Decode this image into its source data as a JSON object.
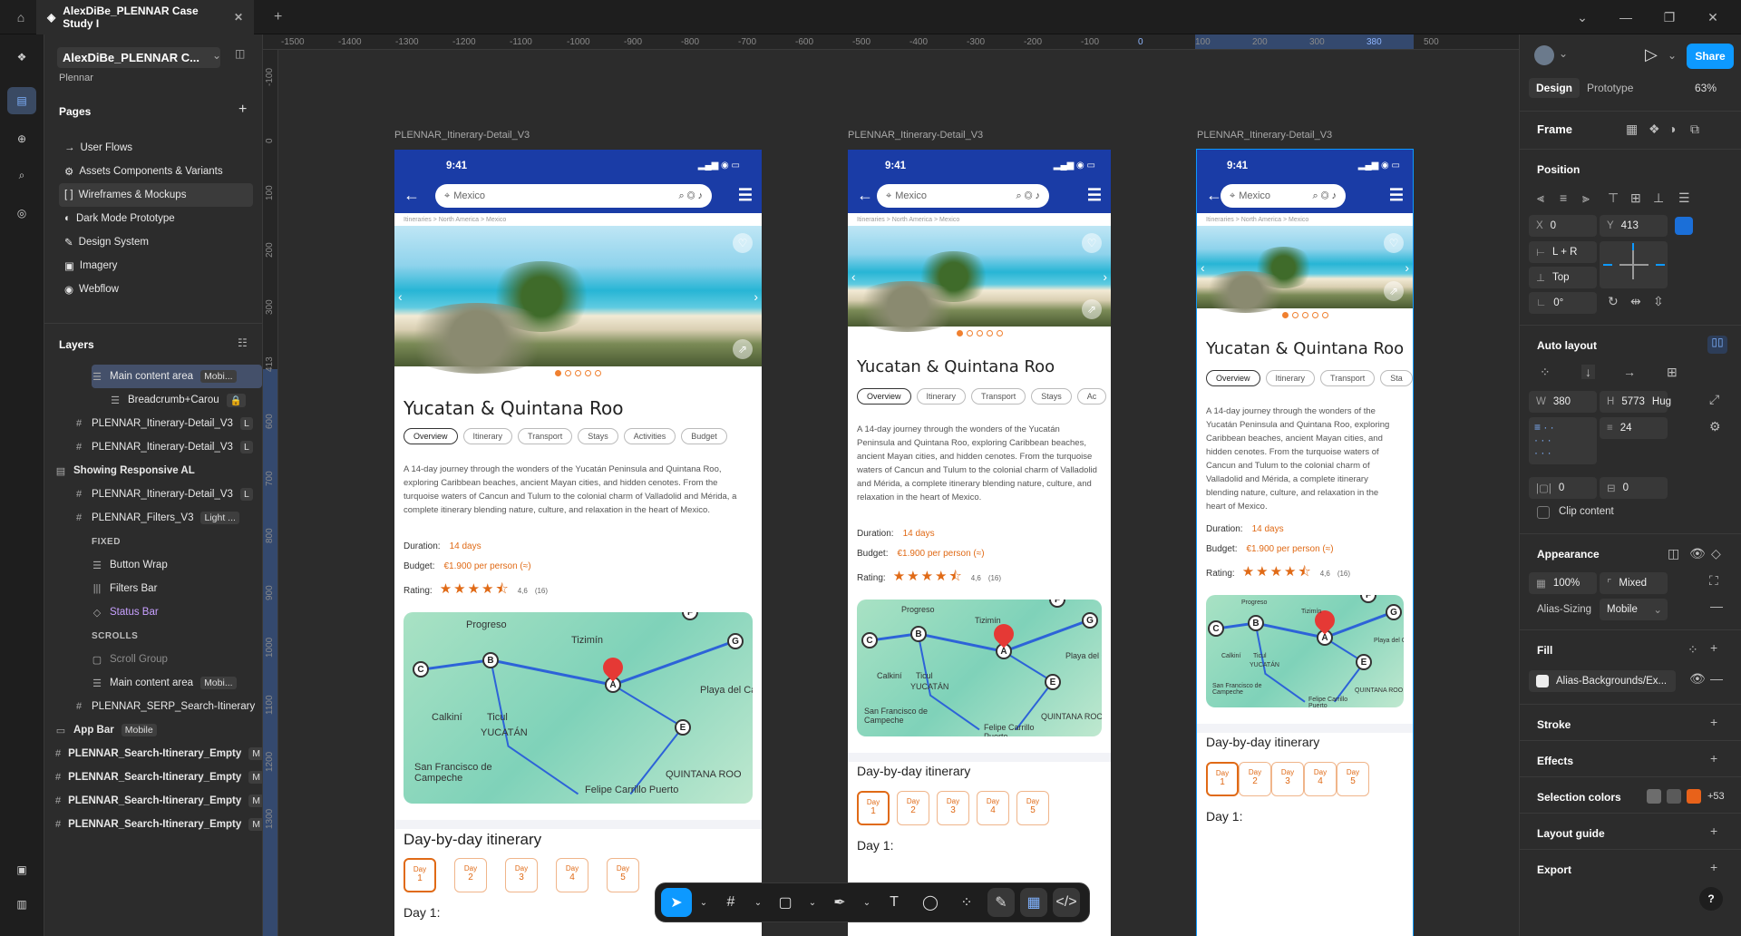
{
  "titlebar": {
    "file_tab": "AlexDiBe_PLENNAR Case Study I",
    "new_tab": "+"
  },
  "left": {
    "file_name": "AlexDiBe_PLENNAR C...",
    "team": "Plennar",
    "pages_title": "Pages",
    "pages": [
      {
        "icon": "→",
        "label": "User Flows"
      },
      {
        "icon": "⚙",
        "label": "Assets Components & Variants"
      },
      {
        "icon": "[ ]",
        "label": "Wireframes & Mockups"
      },
      {
        "icon": "◐",
        "label": "Dark Mode Prototype"
      },
      {
        "icon": "✎",
        "label": "Design System"
      },
      {
        "icon": "▣",
        "label": "Imagery"
      },
      {
        "icon": "◉",
        "label": "Webflow"
      }
    ],
    "layers_title": "Layers",
    "layers": [
      {
        "label": "Main content area",
        "badge": "Mobi...",
        "indent": 44,
        "sel": true,
        "icon": "☰"
      },
      {
        "label": "Breadcrumb+Carou",
        "badge": "🔒",
        "indent": 64,
        "icon": "☰"
      },
      {
        "label": "PLENNAR_Itinerary-Detail_V3",
        "badge": "L",
        "indent": 24,
        "icon": "#"
      },
      {
        "label": "PLENNAR_Itinerary-Detail_V3",
        "badge": "L",
        "indent": 24,
        "icon": "#"
      },
      {
        "label": "Showing Responsive AL",
        "badge": "",
        "indent": 4,
        "icon": "▤",
        "bold": true
      },
      {
        "label": "PLENNAR_Itinerary-Detail_V3",
        "badge": "L",
        "indent": 24,
        "icon": "#"
      },
      {
        "label": "PLENNAR_Filters_V3",
        "badge": "Light ...",
        "indent": 24,
        "icon": "#"
      },
      {
        "label": "FIXED",
        "badge": "",
        "indent": 44,
        "icon": "",
        "section": true
      },
      {
        "label": "Button Wrap",
        "badge": "",
        "indent": 44,
        "icon": "☰"
      },
      {
        "label": "Filters Bar",
        "badge": "",
        "indent": 44,
        "icon": "|||"
      },
      {
        "label": "Status Bar",
        "badge": "",
        "indent": 44,
        "icon": "◇",
        "purple": true
      },
      {
        "label": "SCROLLS",
        "badge": "",
        "indent": 44,
        "icon": "",
        "section": true
      },
      {
        "label": "Scroll Group",
        "badge": "",
        "indent": 44,
        "icon": "▢",
        "dim": true
      },
      {
        "label": "Main content area",
        "badge": "Mobi...",
        "indent": 44,
        "icon": "☰"
      },
      {
        "label": "PLENNAR_SERP_Search-Itinerary",
        "badge": "",
        "indent": 24,
        "icon": "#"
      },
      {
        "label": "App Bar",
        "badge": "Mobile",
        "indent": 4,
        "icon": "▭",
        "bold": true
      },
      {
        "label": "PLENNAR_Search-Itinerary_Empty",
        "badge": "M",
        "indent": 4,
        "icon": "#",
        "bold": true
      },
      {
        "label": "PLENNAR_Search-Itinerary_Empty",
        "badge": "M",
        "indent": 4,
        "icon": "#",
        "bold": true
      },
      {
        "label": "PLENNAR_Search-Itinerary_Empty",
        "badge": "M",
        "indent": 4,
        "icon": "#",
        "bold": true
      },
      {
        "label": "PLENNAR_Search-Itinerary_Empty",
        "badge": "M",
        "indent": 4,
        "icon": "#",
        "bold": true
      }
    ]
  },
  "ruler": {
    "top": [
      "-1500",
      "-1400",
      "-1300",
      "-1200",
      "-1100",
      "-1000",
      "-900",
      "-800",
      "-700",
      "-600",
      "-500",
      "-400",
      "-300",
      "-200",
      "-100",
      "0",
      "100",
      "200",
      "300",
      "380",
      "500"
    ],
    "left": [
      "-100",
      "0",
      "100",
      "200",
      "300",
      "413",
      "600",
      "700",
      "800",
      "900",
      "1000",
      "1100",
      "1200",
      "1300"
    ]
  },
  "frames": [
    {
      "label": "PLENNAR_Itinerary-Detail_V3"
    },
    {
      "label": "PLENNAR_Itinerary-Detail_V3"
    },
    {
      "label": "PLENNAR_Itinerary-Detail_V3"
    }
  ],
  "phone": {
    "time": "9:41",
    "search": "Mexico",
    "crumb": "Itineraries > North America > Mexico",
    "title": "Yucatan & Quintana Roo",
    "tabs": [
      "Overview",
      "Itinerary",
      "Transport",
      "Stays",
      "Activities",
      "Budget"
    ],
    "tabs_third": [
      "Overview",
      "Itinerary",
      "Transport",
      "Sta"
    ],
    "tabs_second": [
      "Overview",
      "Itinerary",
      "Transport",
      "Stays",
      "Ac"
    ],
    "desc": "A 14-day journey through the wonders of the Yucatán Peninsula and Quintana Roo, exploring Caribbean beaches, ancient Mayan cities, and hidden cenotes. From the turquoise waters of Cancun and Tulum to the colonial charm of Valladolid and Mérida, a complete itinerary blending nature, culture, and relaxation in the heart of Mexico.",
    "duration_label": "Duration:",
    "duration": "14 days",
    "budget_label": "Budget:",
    "budget": "€1.900 per person (≈)",
    "rating_label": "Rating:",
    "rating": "4,6",
    "reviews": "(16)",
    "stars": "★★★★⯪",
    "map_labels": [
      "Progreso",
      "Tizimín",
      "Calkiní",
      "Ticul",
      "YUCATÁN",
      "San Francisco de Campeche",
      "Felipe Carrillo Puerto",
      "Playa del Carmen",
      "QUINTANA ROO"
    ],
    "day_title": "Day-by-day itinerary",
    "day_word": "Day",
    "days": [
      "1",
      "2",
      "3",
      "4",
      "5"
    ],
    "day1": "Day 1:"
  },
  "toolbar": {
    "tools": [
      "cursor",
      "frame",
      "rectangle",
      "pen",
      "text",
      "comment",
      "actions",
      "draw",
      "dev",
      "code"
    ]
  },
  "right": {
    "tabs": [
      "Design",
      "Prototype"
    ],
    "zoom": "63%",
    "share": "Share",
    "frame": "Frame",
    "position": "Position",
    "x_label": "X",
    "x": "0",
    "y_label": "Y",
    "y": "413",
    "constraint_h": "L + R",
    "constraint_v": "Top",
    "rotation": "0°",
    "autolayout": "Auto layout",
    "w_label": "W",
    "w": "380",
    "h_label": "H",
    "h": "5773",
    "h_mode": "Hug",
    "gap": "24",
    "pad_h": "0",
    "pad_v": "0",
    "clip": "Clip content",
    "appearance": "Appearance",
    "opacity": "100%",
    "radius": "Mixed",
    "alias_label": "Alias-Sizing",
    "alias": "Mobile",
    "fill": "Fill",
    "fill_value": "Alias-Backgrounds/Ex...",
    "stroke": "Stroke",
    "effects": "Effects",
    "selection_colors": "Selection colors",
    "sel_more": "+53",
    "layout_guide": "Layout guide",
    "export": "Export",
    "sel_swatches": [
      "#6d6d6d",
      "#5a5a5a",
      "#e8621a"
    ]
  }
}
